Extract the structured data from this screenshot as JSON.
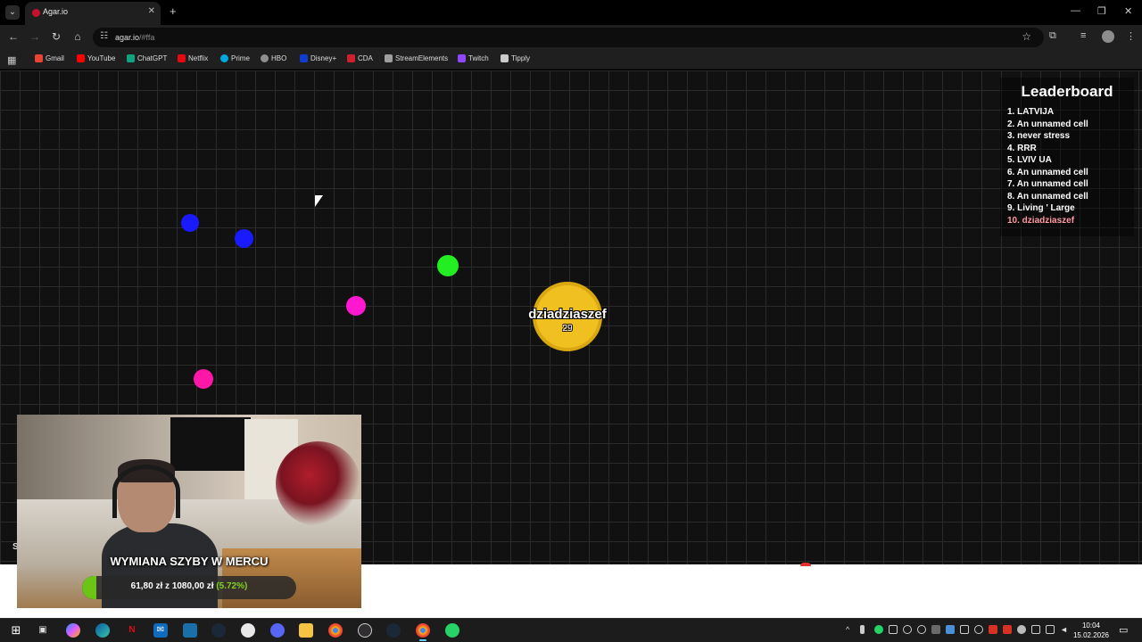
{
  "browser": {
    "tab_title": "Agar.io",
    "url_host": "agar.io",
    "url_path": "/#ffa",
    "bookmarks": [
      {
        "label": "Gmail",
        "color": "#ea4335"
      },
      {
        "label": "YouTube",
        "color": "#ff0000"
      },
      {
        "label": "ChatGPT",
        "color": "#10a37f"
      },
      {
        "label": "Netflix",
        "color": "#e50914"
      },
      {
        "label": "Prime",
        "color": "#00a8e1"
      },
      {
        "label": "HBO",
        "color": "#8f8f8f"
      },
      {
        "label": "Disney+",
        "color": "#113ccf"
      },
      {
        "label": "CDA",
        "color": "#d0202e"
      },
      {
        "label": "StreamElements",
        "color": "#9e9e9e"
      },
      {
        "label": "Twitch",
        "color": "#9146ff"
      },
      {
        "label": "Tipply",
        "color": "#cccccc"
      }
    ]
  },
  "game": {
    "player": {
      "name": "dziadziaszef",
      "mass": "29",
      "color": "#f0c020"
    },
    "pellets": [
      {
        "color": "#1a1aff"
      },
      {
        "color": "#1a1aff"
      },
      {
        "color": "#22ee22"
      },
      {
        "color": "#ff18d0"
      },
      {
        "color": "#ff18a8"
      }
    ],
    "leaderboard": {
      "title": "Leaderboard",
      "entries": [
        "1. LATVIJA",
        "2. An unnamed cell",
        "3. never stress",
        "4. RRR",
        "5. LVIV UA",
        "6. An unnamed cell",
        "7. An unnamed cell",
        "8. An unnamed cell",
        "9. Living ' Large",
        "10. dziadziaszef"
      ],
      "highlight_index": 9,
      "highlight_color": "#ff9aa2"
    }
  },
  "stream_overlay": {
    "goal_title": "WYMIANA SZYBY W MERCU",
    "goal_current": "61,80 zł",
    "goal_connector": "z",
    "goal_target": "1080,00 zł",
    "goal_percent_text": "(5.72%)",
    "goal_progress": 0.0572,
    "goal_color": "#6cc417",
    "side_letter": "S"
  },
  "taskbar": {
    "apps": [
      "start-icon",
      "task-view-icon",
      "copilot-icon",
      "edge-icon",
      "netflix-icon",
      "outlook-icon",
      "mail-icon",
      "steam-icon",
      "app-icon",
      "discord-icon",
      "file-explorer-icon",
      "chrome-icon",
      "obs-icon",
      "steam-icon",
      "chrome-active-icon",
      "whatsapp-icon"
    ],
    "time": "10:04",
    "date": "15.02.2026"
  }
}
